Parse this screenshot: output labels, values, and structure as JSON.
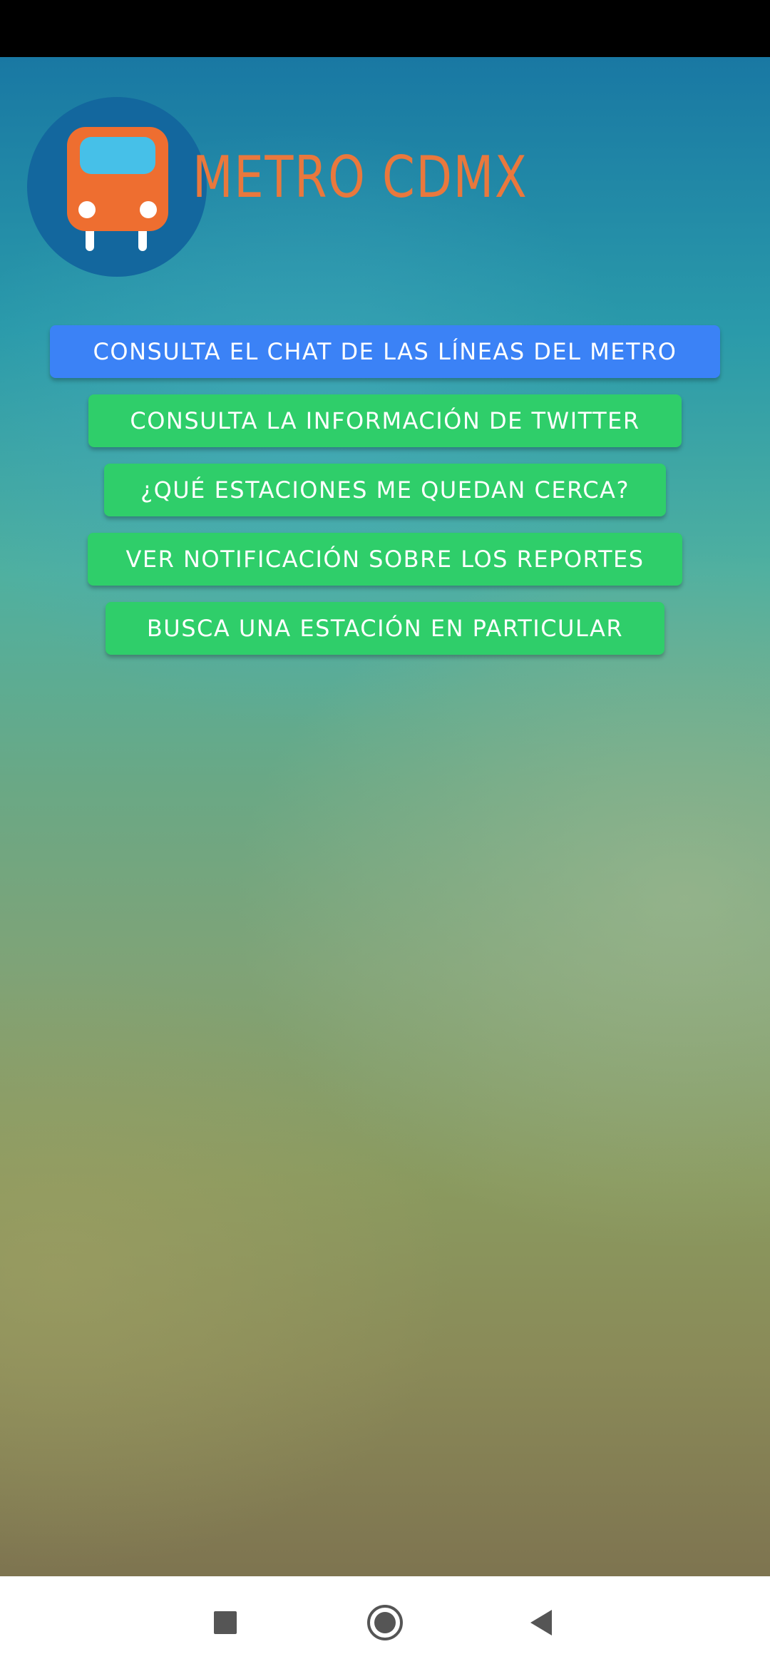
{
  "app": {
    "logo_text": "METRO CDMX",
    "logo_icon": "metro-train-icon",
    "colors": {
      "logo_orange": "#e9783d",
      "logo_circle": "#13679e",
      "primary_button": "#3b82f6",
      "secondary_button": "#2fce6a"
    }
  },
  "menu": {
    "buttons": [
      {
        "label": "CONSULTA EL CHAT DE LAS LÍNEAS DEL METRO"
      },
      {
        "label": "CONSULTA LA INFORMACIÓN DE TWITTER"
      },
      {
        "label": "¿QUÉ ESTACIONES ME QUEDAN CERCA?"
      },
      {
        "label": "VER NOTIFICACIÓN SOBRE LOS REPORTES"
      },
      {
        "label": "BUSCA UNA ESTACIÓN EN PARTICULAR"
      }
    ]
  },
  "navigation": {
    "recents_icon": "square-recents-icon",
    "home_icon": "circle-home-icon",
    "back_icon": "triangle-back-icon"
  }
}
